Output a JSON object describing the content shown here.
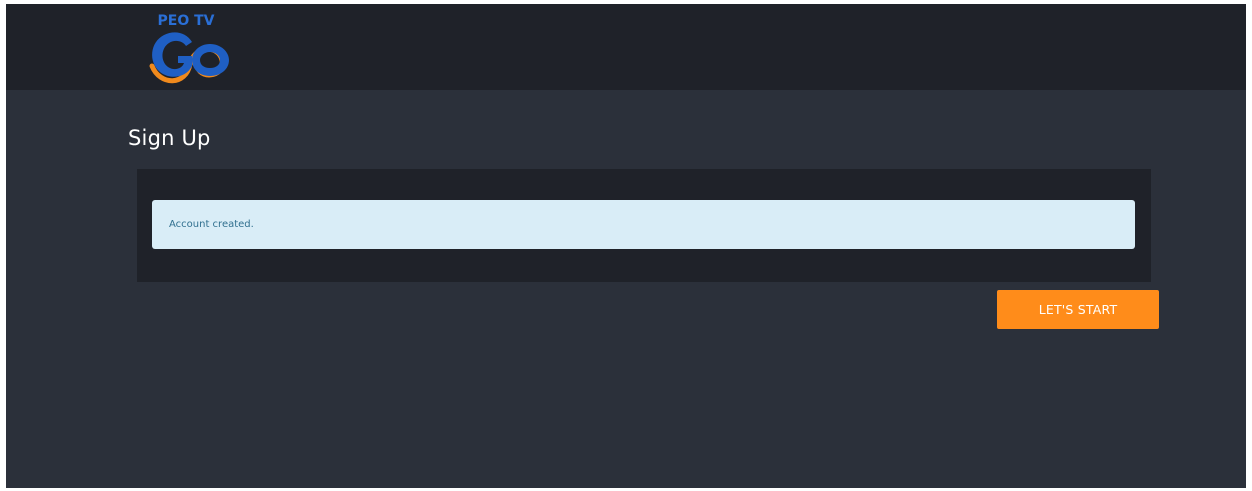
{
  "header": {
    "logo_text": "PEO TV",
    "logo_alt": "PEO TV GO",
    "logo_icon": "peotv-go-logo",
    "colors": {
      "logo_text": "#2a6fd6",
      "logo_blue": "#1f5fc4",
      "logo_orange": "#f08a1d"
    }
  },
  "page": {
    "title": "Sign Up"
  },
  "alert": {
    "message": "Account created.",
    "colors": {
      "background": "#d9edf7",
      "text": "#31708f"
    }
  },
  "actions": {
    "start_label": "LET'S START",
    "color": "#ff8c1a"
  },
  "theme": {
    "background": "#2b303a",
    "topbar": "#1f2229"
  }
}
